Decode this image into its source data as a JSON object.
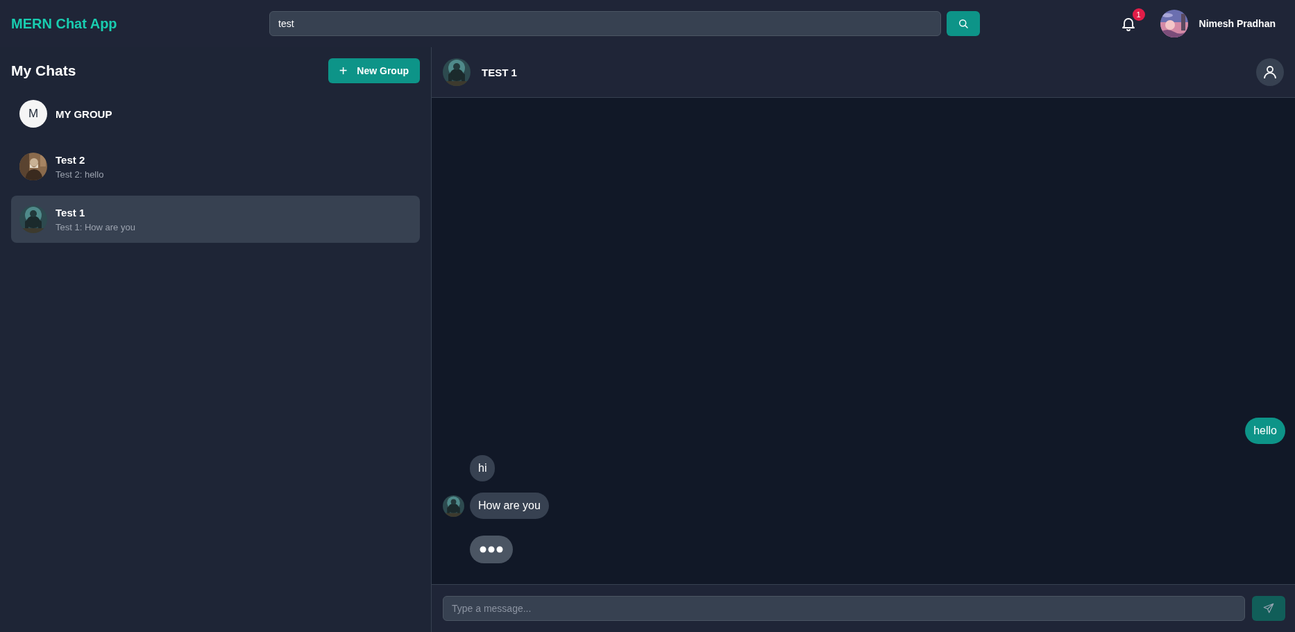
{
  "app": {
    "title": "MERN Chat App"
  },
  "search": {
    "value": "test"
  },
  "notifications": {
    "count": "1"
  },
  "user": {
    "name": "Nimesh Pradhan"
  },
  "sidebar": {
    "title": "My Chats",
    "new_group_button": {
      "icon": "+",
      "label": "New Group"
    },
    "chats": [
      {
        "name": "MY GROUP",
        "avatar": {
          "kind": "letter",
          "letter": "M"
        },
        "selected": false
      },
      {
        "name": "Test 2",
        "preview": "Test 2: hello",
        "selected": false
      },
      {
        "name": "Test 1",
        "preview": "Test 1: How are you",
        "selected": true
      }
    ]
  },
  "conversation": {
    "title": "TEST 1",
    "messages": [
      {
        "kind": "own",
        "text": "hello"
      },
      {
        "kind": "other",
        "text": "hi",
        "show_avatar": false
      },
      {
        "kind": "other",
        "text": "How are you",
        "show_avatar": true
      }
    ],
    "typing": true,
    "composer": {
      "placeholder": "Type a message..."
    }
  }
}
